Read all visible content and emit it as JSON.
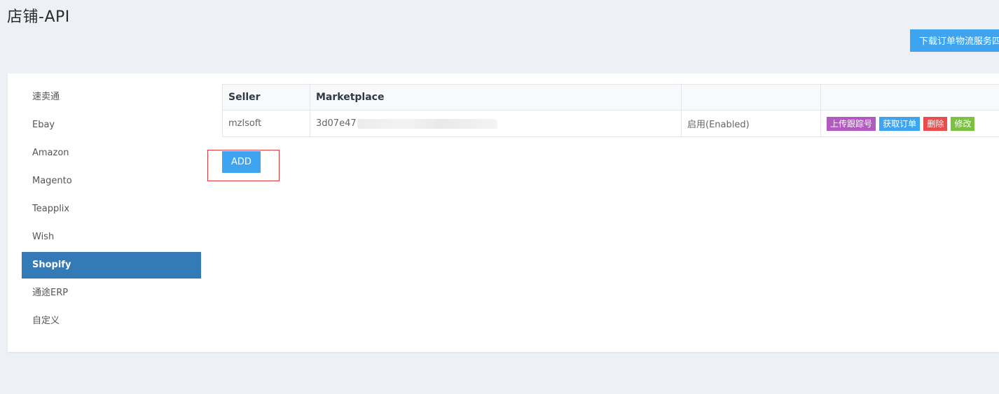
{
  "header": {
    "title": "店铺-API",
    "download_button_label": "下载订单物流服务四"
  },
  "sidebar": {
    "items": [
      {
        "label": "速卖通",
        "active": false
      },
      {
        "label": "Ebay",
        "active": false
      },
      {
        "label": "Amazon",
        "active": false
      },
      {
        "label": "Magento",
        "active": false
      },
      {
        "label": "Teapplix",
        "active": false
      },
      {
        "label": "Wish",
        "active": false
      },
      {
        "label": "Shopify",
        "active": true
      },
      {
        "label": "通途ERP",
        "active": false
      },
      {
        "label": "自定义",
        "active": false
      }
    ]
  },
  "table": {
    "columns": [
      "Seller",
      "Marketplace",
      "",
      ""
    ],
    "rows": [
      {
        "seller": "mzlsoft",
        "marketplace": "3d07e47",
        "status": "启用(Enabled)",
        "actions": {
          "upload_tracking": "上传跟踪号",
          "fetch_orders": "获取订单",
          "delete": "删除",
          "edit": "修改"
        }
      }
    ]
  },
  "add_button_label": "ADD",
  "colors": {
    "accent": "#3fa4ef",
    "active_nav": "#337ab7",
    "upload": "#b35ac2",
    "delete": "#e84c4c",
    "edit": "#7cc142",
    "highlight": "#e23a3a"
  }
}
